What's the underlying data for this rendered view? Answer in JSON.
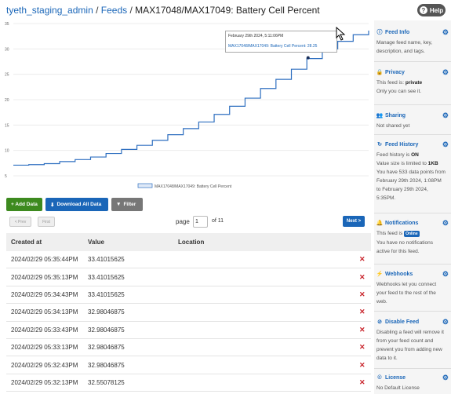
{
  "breadcrumb": {
    "user": "tyeth_staging_admin",
    "sep1": "/",
    "feeds": "Feeds",
    "sep2": "/",
    "title": "MAX17048/MAX17049: Battery Cell Percent"
  },
  "help_label": "Help",
  "chart_data": {
    "type": "line",
    "x": [
      "2024-02-29T13:08",
      "2024-02-29T13:20",
      "2024-02-29T13:31",
      "2024-02-29T13:43",
      "2024-02-29T13:54",
      "2024-02-29T14:06",
      "2024-02-29T14:17",
      "2024-02-29T14:29",
      "2024-02-29T14:41",
      "2024-02-29T14:52",
      "2024-02-29T15:04",
      "2024-02-29T15:15",
      "2024-02-29T15:27",
      "2024-02-29T15:38",
      "2024-02-29T15:50",
      "2024-02-29T16:02",
      "2024-02-29T16:13",
      "2024-02-29T16:25",
      "2024-02-29T16:36",
      "2024-02-29T16:48",
      "2024-02-29T16:59",
      "2024-02-29T17:11",
      "2024-02-29T17:23",
      "2024-02-29T17:35"
    ],
    "series": [
      {
        "name": "MAX17048/MAX17049: Battery Cell Percent",
        "values": [
          7.1,
          7.2,
          7.4,
          7.8,
          8.2,
          8.7,
          9.4,
          10.2,
          11.0,
          12.0,
          13.1,
          14.3,
          15.6,
          17.1,
          18.7,
          20.3,
          22.2,
          24.0,
          26.0,
          28.1,
          30.0,
          31.5,
          32.8,
          33.6
        ]
      }
    ],
    "ylim": [
      5,
      35
    ],
    "yticks": [
      "5",
      "10",
      "15",
      "20",
      "25",
      "30",
      "35"
    ],
    "grid": true,
    "legend": "bottom",
    "tooltip": {
      "date": "February 29th 2024, 5:11:06PM",
      "series": "MAX17048/MAX17049: Battery Cell Percent",
      "value": "28.25"
    }
  },
  "toolbar": {
    "add_data": "+ Add Data",
    "download": "Download All Data",
    "filter": "Filter"
  },
  "pager": {
    "prev": "< Prev",
    "first": "First",
    "page_label": "page",
    "page_value": "1",
    "page_total": "of 11",
    "next": "Next >"
  },
  "table": {
    "headers": [
      "Created at",
      "Value",
      "Location"
    ],
    "rows": [
      {
        "created": "2024/02/29 05:35:44PM",
        "value": "33.41015625"
      },
      {
        "created": "2024/02/29 05:35:13PM",
        "value": "33.41015625"
      },
      {
        "created": "2024/02/29 05:34:43PM",
        "value": "33.41015625"
      },
      {
        "created": "2024/02/29 05:34:13PM",
        "value": "32.98046875"
      },
      {
        "created": "2024/02/29 05:33:43PM",
        "value": "32.98046875"
      },
      {
        "created": "2024/02/29 05:33:13PM",
        "value": "32.98046875"
      },
      {
        "created": "2024/02/29 05:32:43PM",
        "value": "32.98046875"
      },
      {
        "created": "2024/02/29 05:32:13PM",
        "value": "32.55078125"
      }
    ],
    "delete_glyph": "✕"
  },
  "sidebar": {
    "feed_info": {
      "title": "Feed Info",
      "body": "Manage feed name, key, description, and tags."
    },
    "privacy": {
      "title": "Privacy",
      "body1": "This feed is:",
      "status": "private",
      "body2": "Only you can see it."
    },
    "sharing": {
      "title": "Sharing",
      "body": "Not shared yet"
    },
    "history": {
      "title": "Feed History",
      "body1": "Feed history is",
      "status": "ON",
      "body2": "Value size is limited to",
      "limit": "1KB",
      "body3": "You have 533 data points from February 29th 2024, 1:08PM to February 29th 2024, 5:35PM."
    },
    "notifications": {
      "title": "Notifications",
      "body1": "This feed is",
      "badge": "Online",
      "body2": "You have no notifications active for this feed."
    },
    "webhooks": {
      "title": "Webhooks",
      "body": "Webhooks let you connect your feed to the rest of the web."
    },
    "disable": {
      "title": "Disable Feed",
      "body": "Disabling a feed will remove it from your feed count and prevent you from adding new data to it."
    },
    "license": {
      "title": "License",
      "body": "No Default License"
    }
  }
}
